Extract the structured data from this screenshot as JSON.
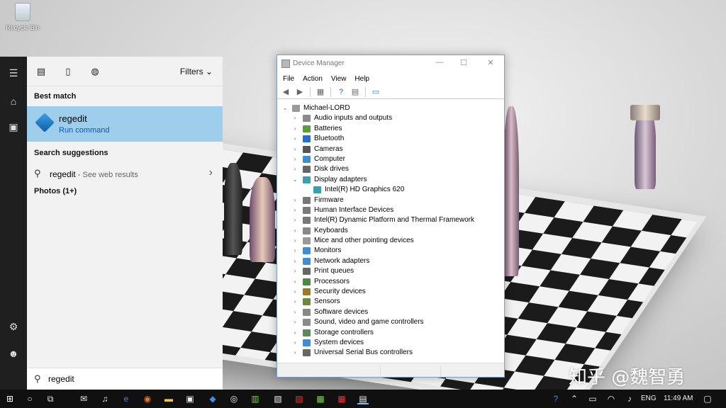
{
  "desktop": {
    "recycle_bin_label": "Recycle Bin",
    "watermark": "知乎 @魏智勇"
  },
  "start": {
    "rail_icons": [
      "hamburger-icon",
      "home-icon",
      "documents-icon",
      "settings-icon",
      "user-icon"
    ],
    "filters_label": "Filters",
    "best_match_heading": "Best match",
    "best_match": {
      "title": "regedit",
      "subtitle": "Run command"
    },
    "search_suggestions_heading": "Search suggestions",
    "suggestion": {
      "text": "regedit",
      "suffix": " - See web results"
    },
    "photos_heading": "Photos (1+)",
    "search_value": "regedit",
    "accent_color": "#9fcdec"
  },
  "device_manager": {
    "title": "Device Manager",
    "menu": [
      "File",
      "Action",
      "View",
      "Help"
    ],
    "root": "Michael-LORD",
    "nodes": [
      {
        "label": "Audio inputs and outputs",
        "icon": "speaker-icon",
        "expanded": false
      },
      {
        "label": "Batteries",
        "icon": "battery-icon",
        "expanded": false
      },
      {
        "label": "Bluetooth",
        "icon": "bluetooth-icon",
        "expanded": false
      },
      {
        "label": "Cameras",
        "icon": "camera-icon",
        "expanded": false
      },
      {
        "label": "Computer",
        "icon": "monitor-icon",
        "expanded": false
      },
      {
        "label": "Disk drives",
        "icon": "disk-icon",
        "expanded": false
      },
      {
        "label": "Display adapters",
        "icon": "display-icon",
        "expanded": true,
        "children": [
          "Intel(R) HD Graphics 620"
        ]
      },
      {
        "label": "Firmware",
        "icon": "chip-icon",
        "expanded": false
      },
      {
        "label": "Human Interface Devices",
        "icon": "hid-icon",
        "expanded": false
      },
      {
        "label": "Intel(R) Dynamic Platform and Thermal Framework",
        "icon": "chip-icon",
        "expanded": false
      },
      {
        "label": "Keyboards",
        "icon": "keyboard-icon",
        "expanded": false
      },
      {
        "label": "Mice and other pointing devices",
        "icon": "mouse-icon",
        "expanded": false
      },
      {
        "label": "Monitors",
        "icon": "monitor-icon",
        "expanded": false
      },
      {
        "label": "Network adapters",
        "icon": "network-icon",
        "expanded": false
      },
      {
        "label": "Print queues",
        "icon": "printer-icon",
        "expanded": false
      },
      {
        "label": "Processors",
        "icon": "cpu-icon",
        "expanded": false
      },
      {
        "label": "Security devices",
        "icon": "security-icon",
        "expanded": false
      },
      {
        "label": "Sensors",
        "icon": "sensor-icon",
        "expanded": false
      },
      {
        "label": "Software devices",
        "icon": "software-icon",
        "expanded": false
      },
      {
        "label": "Sound, video and game controllers",
        "icon": "speaker-icon",
        "expanded": false
      },
      {
        "label": "Storage controllers",
        "icon": "storage-icon",
        "expanded": false
      },
      {
        "label": "System devices",
        "icon": "system-icon",
        "expanded": false
      },
      {
        "label": "Universal Serial Bus controllers",
        "icon": "usb-icon",
        "expanded": false
      }
    ]
  },
  "taskbar": {
    "language": "ENG",
    "time": "11:49 AM"
  }
}
